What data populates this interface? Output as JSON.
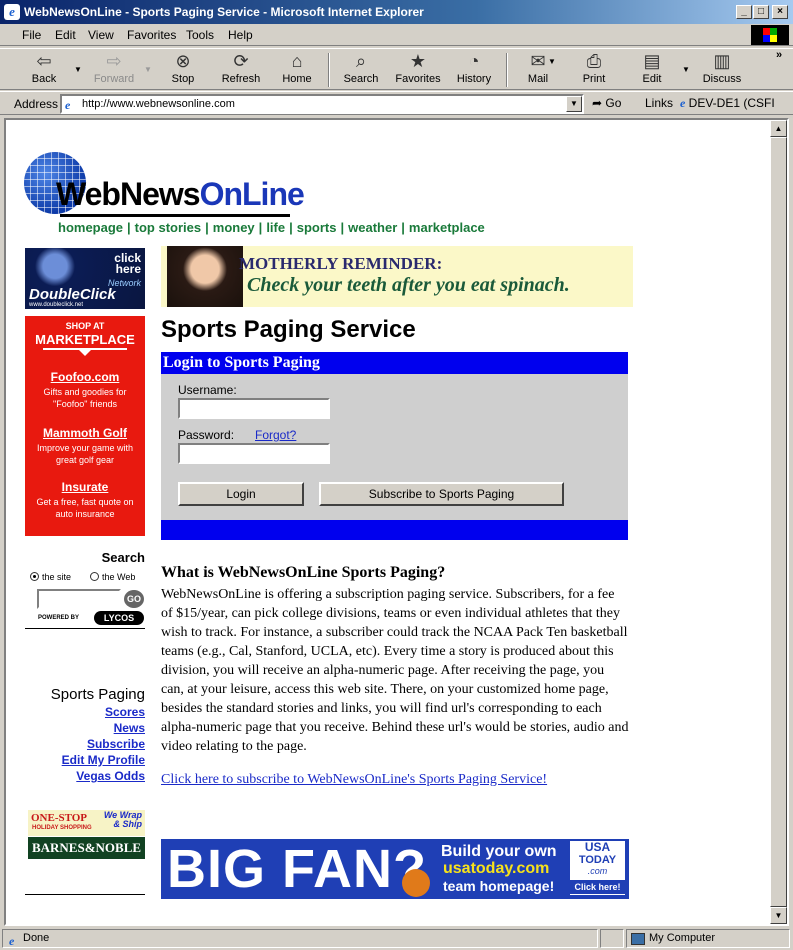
{
  "window": {
    "title": "WebNewsOnLine - Sports Paging Service - Microsoft Internet Explorer",
    "minimize": "_",
    "maximize": "□",
    "close": "×"
  },
  "menu": [
    "File",
    "Edit",
    "View",
    "Favorites",
    "Tools",
    "Help"
  ],
  "toolbar": {
    "back": "Back",
    "forward": "Forward",
    "stop": "Stop",
    "refresh": "Refresh",
    "home": "Home",
    "search": "Search",
    "favorites": "Favorites",
    "history": "History",
    "mail": "Mail",
    "print": "Print",
    "edit": "Edit",
    "discuss": "Discuss"
  },
  "address": {
    "label": "Address",
    "url": "http://www.webnewsonline.com",
    "go": "Go",
    "links": "Links",
    "link1": "DEV-DE1 (CSFI"
  },
  "site": {
    "logo_web": "WebNews",
    "logo_online": "OnLine",
    "nav": [
      "homepage",
      "top stories",
      "money",
      "life",
      "sports",
      "weather",
      "marketplace"
    ]
  },
  "ads": {
    "doubleclick": {
      "click_here": "click here",
      "network": "Network",
      "brand": "DoubleClick",
      "url": "www.doubleclick.net"
    },
    "marketplace": {
      "shop_at": "SHOP AT",
      "title": "MARKETPLACE",
      "items": [
        {
          "name": "Foofoo.com",
          "desc": "Gifts and goodies for \"Foofoo\" friends"
        },
        {
          "name": "Mammoth Golf",
          "desc": "Improve your game with great golf gear"
        },
        {
          "name": "Insurate",
          "desc": "Get a free, fast quote on auto insurance"
        }
      ]
    },
    "reminder": {
      "line1": "MOTHERLY REMINDER:",
      "line2": "Check your teeth after you eat spinach."
    },
    "barnes": {
      "one_stop": "ONE-STOP",
      "holiday": "HOLIDAY SHOPPING",
      "wrap": "We Wrap",
      "ship": "& Ship",
      "brand": "BARNES&NOBLE"
    },
    "bigfan": {
      "big": "BIG FAN?",
      "line1": "Build your own",
      "line2": "usatoday.com",
      "line3": "team homepage!",
      "usa1": "USA",
      "usa2": "TODAY",
      "usa3": ".com",
      "click": "Click here!"
    }
  },
  "search": {
    "title": "Search",
    "opt_site": "the site",
    "opt_web": "the Web",
    "go": "GO",
    "powered_by": "POWERED BY",
    "lycos": "LYCOS"
  },
  "sports_paging_nav": {
    "title": "Sports Paging",
    "links": [
      "Scores",
      "News",
      "Subscribe",
      "Edit My Profile",
      "Vegas Odds"
    ]
  },
  "main": {
    "heading": "Sports Paging Service",
    "login": {
      "header": "Login to Sports Paging",
      "username_label": "Username:",
      "username_value": "",
      "password_label": "Password:",
      "password_value": "",
      "forgot": "Forgot?",
      "login_button": "Login",
      "subscribe_button": "Subscribe to Sports Paging"
    },
    "question": "What is WebNewsOnLine Sports Paging?",
    "body": "WebNewsOnLine is offering a subscription paging service. Subscribers, for a fee of $15/year, can pick college divisions, teams or even individual athletes that they wish to track. For instance, a subscriber could track the NCAA Pack Ten basketball teams (e.g., Cal, Stanford, UCLA, etc). Every time a story is produced about this division, you will receive an alpha-numeric page. After receiving the page, you can, at your leisure, access this web site. There, on your customized home page, besides the standard stories and links, you will find url's corresponding to each alpha-numeric page that you receive. Behind these url's would be stories, audio and video relating to the page.",
    "subscribe_link": "Click here to subscribe to WebNewsOnLine's Sports Paging Service!"
  },
  "status": {
    "text": "Done",
    "zone": "My Computer"
  }
}
